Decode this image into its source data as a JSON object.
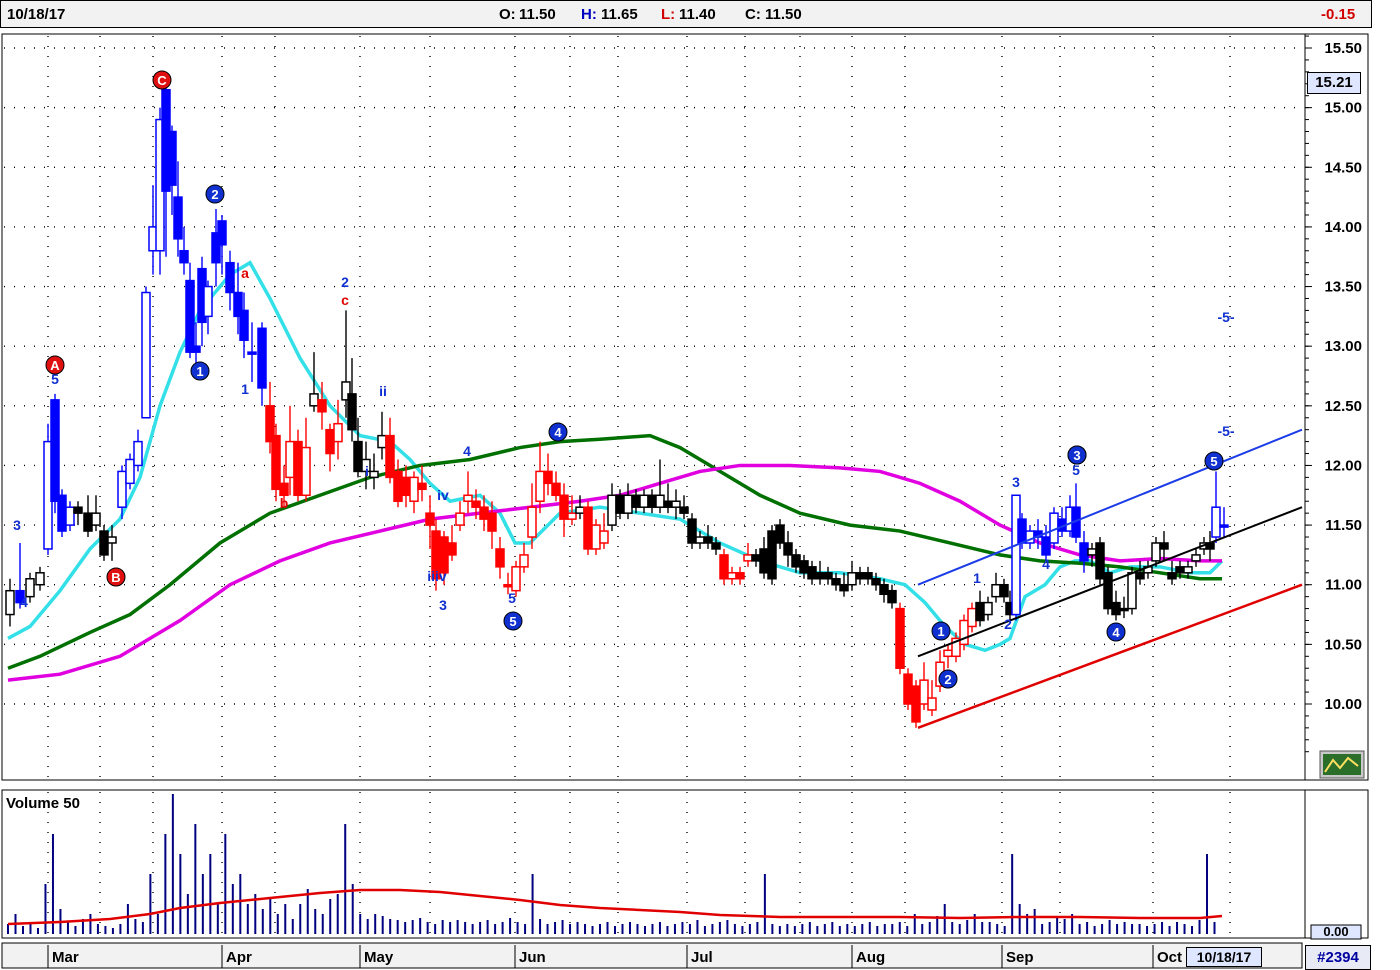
{
  "header": {
    "date": "10/18/17",
    "open_label": "O:",
    "open": "11.50",
    "high_label": "H:",
    "high": "11.65",
    "low_label": "L:",
    "low": "11.40",
    "close_label": "C:",
    "close": "11.50",
    "change": "-0.15"
  },
  "price_tag": "15.21",
  "volume_title": "Volume 50",
  "volume_axis_label": "0.00",
  "date_box": "10/18/17",
  "badge": "#2394",
  "chart_data": {
    "type": "candlestick",
    "ylim": [
      9.5,
      15.7
    ],
    "yticks": [
      "15.50",
      "15.00",
      "14.50",
      "14.00",
      "13.50",
      "13.00",
      "12.50",
      "12.00",
      "11.50",
      "11.00",
      "10.50",
      "10.00"
    ],
    "months": [
      "Mar",
      "Apr",
      "May",
      "Jun",
      "Jul",
      "Aug",
      "Sep",
      "Oct"
    ],
    "colors": {
      "up_blue": "#0000ff",
      "red": "#ff0000",
      "black": "#000000",
      "cyan": "#33e0e8",
      "green": "#007000",
      "magenta": "#e000e0",
      "vol": "#000080",
      "vol_avg": "#e00000"
    },
    "annotations": [
      {
        "t": "A",
        "style": "red-circle"
      },
      {
        "t": "B",
        "style": "red-circle"
      },
      {
        "t": "C",
        "style": "red-circle"
      },
      {
        "t": "1",
        "style": "blue-circle"
      },
      {
        "t": "2",
        "style": "blue-circle"
      },
      {
        "t": "3",
        "style": "blue-circle"
      },
      {
        "t": "4",
        "style": "blue-circle"
      },
      {
        "t": "5",
        "style": "blue-circle"
      },
      {
        "t": "1",
        "style": "blue-circle"
      },
      {
        "t": "2",
        "style": "blue-circle"
      },
      {
        "t": "3",
        "style": "blue-circle"
      },
      {
        "t": "4",
        "style": "blue-circle"
      },
      {
        "t": "5",
        "style": "blue-circle"
      },
      {
        "t": "3",
        "style": "blue-text"
      },
      {
        "t": "4",
        "style": "blue-text"
      },
      {
        "t": "5",
        "style": "blue-text"
      },
      {
        "t": "1",
        "style": "blue-text"
      },
      {
        "t": "a",
        "style": "red-text"
      },
      {
        "t": "b",
        "style": "red-text"
      },
      {
        "t": "2",
        "style": "blue-text"
      },
      {
        "t": "c",
        "style": "red-text"
      },
      {
        "t": "ii",
        "style": "blue-text"
      },
      {
        "t": "i",
        "style": "blue-text"
      },
      {
        "t": "iv",
        "style": "blue-text"
      },
      {
        "t": "iiiv",
        "style": "blue-text"
      },
      {
        "t": "4",
        "style": "blue-text"
      },
      {
        "t": "3",
        "style": "blue-text"
      },
      {
        "t": "5",
        "style": "blue-text"
      },
      {
        "t": "3",
        "style": "blue-text"
      },
      {
        "t": "1",
        "style": "blue-text"
      },
      {
        "t": "2",
        "style": "blue-text"
      },
      {
        "t": "4",
        "style": "blue-text"
      },
      {
        "t": "5",
        "style": "blue-text"
      },
      {
        "t": "-5-",
        "style": "blue-text"
      },
      {
        "t": "-5-",
        "style": "blue-text"
      }
    ]
  }
}
